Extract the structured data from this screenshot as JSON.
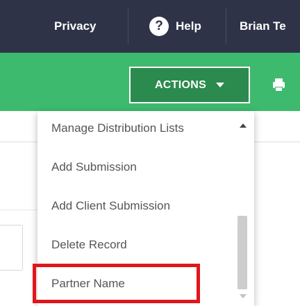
{
  "topbar": {
    "privacy_label": "Privacy",
    "help_icon": "question-circle-icon",
    "help_label": "Help",
    "user_name": "Brian Te"
  },
  "toolbar": {
    "actions_label": "ACTIONS",
    "caret_icon": "caret-down-icon",
    "print_icon": "print-icon"
  },
  "actions_menu": {
    "items": [
      {
        "label": "Manage Distribution Lists"
      },
      {
        "label": "Add Submission"
      },
      {
        "label": "Add Client Submission"
      },
      {
        "label": "Delete Record"
      },
      {
        "label": "Partner Name"
      }
    ],
    "highlighted_item": "Partner Name"
  },
  "colors": {
    "topbar_bg": "#2e3348",
    "toolbar_green": "#3dba6d",
    "button_green": "#2b8a4d",
    "highlight_red": "#e0161c",
    "menu_text": "#555555"
  }
}
